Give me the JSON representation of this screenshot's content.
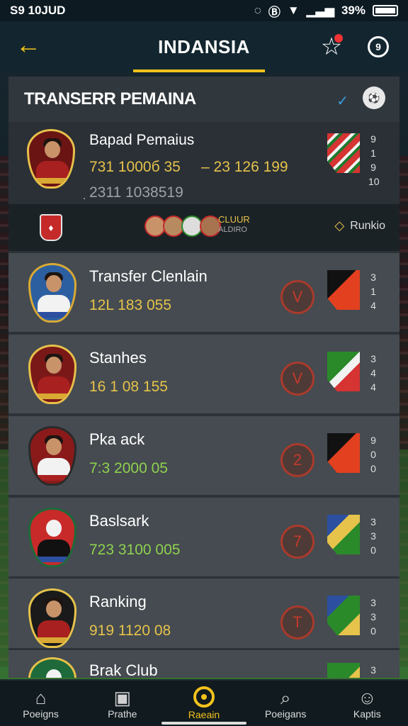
{
  "status": {
    "time": "S9 10JUD",
    "battery_pct": "39%"
  },
  "header": {
    "title": "INDANSIA",
    "accent": "#f2c21b",
    "back_icon": "arrow-left-icon",
    "star_icon": "star-icon",
    "chat_icon": "chat-icon"
  },
  "panel": {
    "title": "TRANSERR PEMAINA",
    "featured": {
      "name": "Bapad Pemaius",
      "value1": "731 1000б 35",
      "value2": "– 23 126 199",
      "value3": "̣2311 1038519",
      "side_digits": [
        "9",
        "1",
        "9",
        "10"
      ]
    },
    "club_strip": {
      "club_label": "CLUUR",
      "club_sub": "ALDIRO",
      "ranking_label": "Runkio"
    },
    "rows": [
      {
        "name": "Transfer Clenlain",
        "value": "12L 183 055",
        "rank": "V",
        "value_color": "#e6c34b",
        "digits": [
          "3",
          "1",
          "4"
        ]
      },
      {
        "name": "Stanhes",
        "value": "16 1 08 155",
        "rank": "V",
        "value_color": "#e6c34b",
        "digits": [
          "3",
          "4",
          "4"
        ]
      },
      {
        "name": "Pka ack",
        "value": "7:3 2000 05",
        "rank": "2",
        "value_color": "#8fd14f",
        "digits": [
          "9",
          "0",
          "0"
        ]
      },
      {
        "name": "Baslsark",
        "value": "723 3100 005",
        "rank": "7",
        "value_color": "#8fd14f",
        "digits": [
          "3",
          "3",
          "0"
        ]
      },
      {
        "name": "Ranking",
        "value": "919 1120 08",
        "rank": "T",
        "value_color": "#e6c34b",
        "digits": [
          "3",
          "3",
          "0"
        ]
      },
      {
        "name": "Brak Club",
        "value": "",
        "rank": "",
        "value_color": "#e6c34b",
        "digits": [
          "3"
        ]
      }
    ]
  },
  "nav": [
    {
      "label": "Poeigns",
      "icon": "home-icon"
    },
    {
      "label": "Prathe",
      "icon": "gift-icon"
    },
    {
      "label": "Raeain",
      "icon": "target-icon",
      "active": true
    },
    {
      "label": "Poeigans",
      "icon": "search-icon"
    },
    {
      "label": "Kaptis",
      "icon": "user-icon"
    }
  ]
}
